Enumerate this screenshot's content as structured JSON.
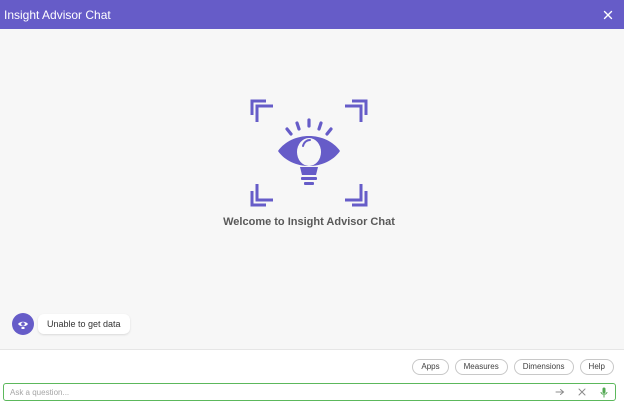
{
  "window": {
    "title": "Insight Advisor Chat",
    "close_icon": "close-icon"
  },
  "main": {
    "welcome_text": "Welcome to Insight Advisor Chat",
    "hero_icon": "lightbulb-eye-icon"
  },
  "messages": [
    {
      "sender": "bot",
      "avatar_icon": "bot-avatar-icon",
      "text": "Unable to get data"
    }
  ],
  "chips": [
    {
      "label": "Apps"
    },
    {
      "label": "Measures"
    },
    {
      "label": "Dimensions"
    },
    {
      "label": "Help"
    }
  ],
  "input": {
    "placeholder": "Ask a question...",
    "value": "",
    "send_icon": "arrow-right-icon",
    "clear_icon": "clear-icon",
    "mic_icon": "microphone-icon"
  },
  "colors": {
    "brand": "#665cc8",
    "input_border": "#5cb85c",
    "mic": "#52a852"
  }
}
